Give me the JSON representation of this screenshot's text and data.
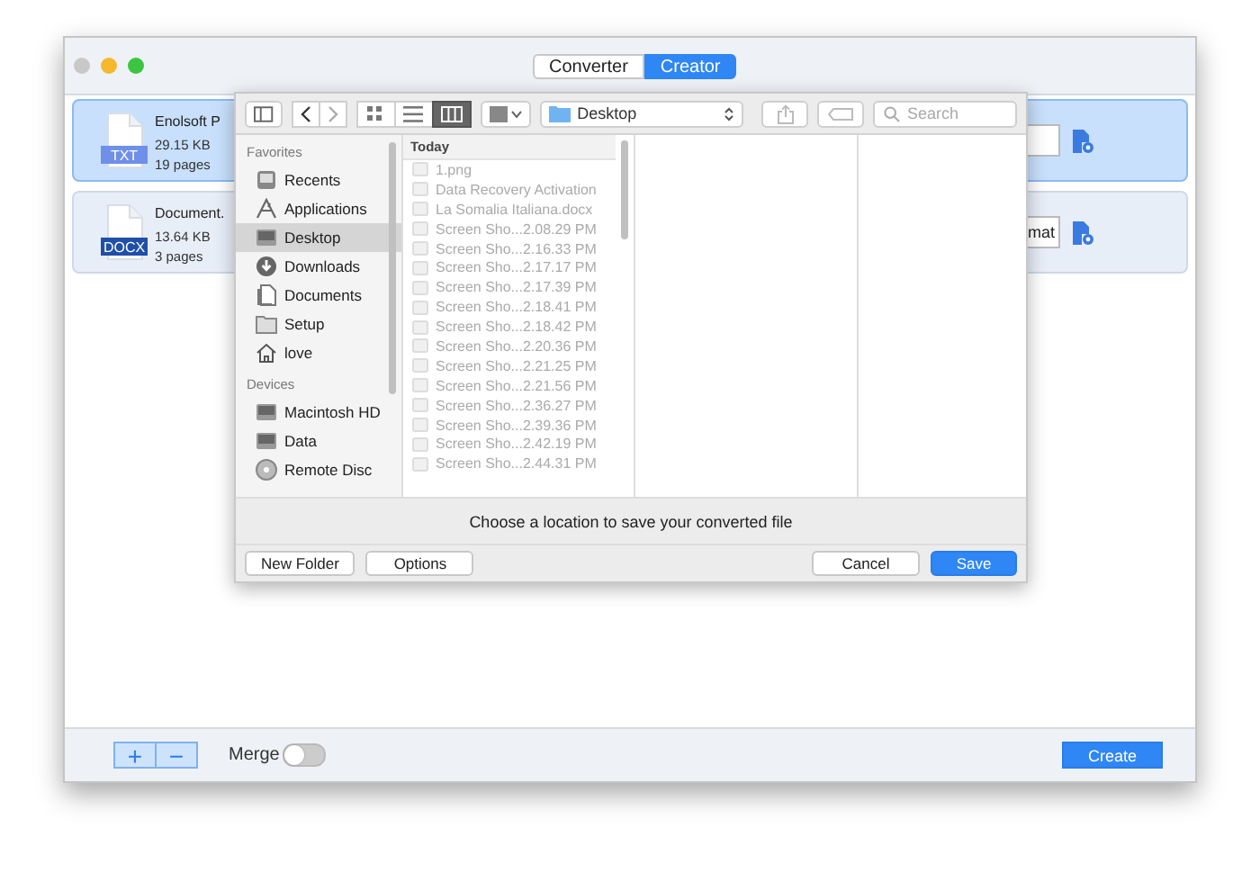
{
  "window": {
    "tabs": [
      {
        "label": "Converter",
        "selected": false
      },
      {
        "label": "Creator",
        "selected": true
      }
    ]
  },
  "files": [
    {
      "name": "Enolsoft P",
      "format": "TXT",
      "color": "#6f8fe8",
      "size": "29.15 KB",
      "pages": "19 pages",
      "selected": true
    },
    {
      "name": "Document.",
      "format": "DOCX",
      "color": "#1f4fa8",
      "size": "13.64 KB",
      "pages": "3 pages",
      "selected": false,
      "field_value": "mat"
    }
  ],
  "bottom_bar": {
    "add": "+",
    "remove": "−",
    "merge": {
      "label": "Merge",
      "on": false
    },
    "create": "Create"
  },
  "save_sheet": {
    "views": [
      {
        "kind": "icons",
        "selected": false
      },
      {
        "kind": "list",
        "selected": false
      },
      {
        "kind": "columns",
        "selected": true
      }
    ],
    "location": "Desktop",
    "search_placeholder": "Search",
    "sidebar": [
      {
        "heading": "Favorites",
        "items": [
          {
            "label": "Recents",
            "kind": "clock",
            "selected": false
          },
          {
            "label": "Applications",
            "kind": "apps",
            "selected": false
          },
          {
            "label": "Desktop",
            "kind": "drive",
            "selected": true
          },
          {
            "label": "Downloads",
            "kind": "download",
            "selected": false
          },
          {
            "label": "Documents",
            "kind": "document",
            "selected": false
          },
          {
            "label": "Setup",
            "kind": "folder",
            "selected": false
          },
          {
            "label": "love",
            "kind": "home",
            "selected": false
          }
        ]
      },
      {
        "heading": "Devices",
        "items": [
          {
            "label": "Macintosh HD",
            "kind": "drive",
            "selected": false
          },
          {
            "label": "Data",
            "kind": "drive",
            "selected": false
          },
          {
            "label": "Remote Disc",
            "kind": "disc",
            "selected": false
          }
        ]
      }
    ],
    "column_heading": "Today",
    "entries": [
      "1.png",
      "Data Recovery Activation",
      "La Somalia Italiana.docx",
      "Screen Sho...2.08.29 PM",
      "Screen Sho...2.16.33 PM",
      "Screen Sho...2.17.17 PM",
      "Screen Sho...2.17.39 PM",
      "Screen Sho...2.18.41 PM",
      "Screen Sho...2.18.42 PM",
      "Screen Sho...2.20.36 PM",
      "Screen Sho...2.21.25 PM",
      "Screen Sho...2.21.56 PM",
      "Screen Sho...2.36.27 PM",
      "Screen Sho...2.39.36 PM",
      "Screen Sho...2.42.19 PM",
      "Screen Sho...2.44.31 PM"
    ],
    "message": "Choose a location to save your converted file",
    "buttons": {
      "new_folder": "New Folder",
      "options": "Options",
      "cancel": "Cancel",
      "save": "Save"
    }
  }
}
